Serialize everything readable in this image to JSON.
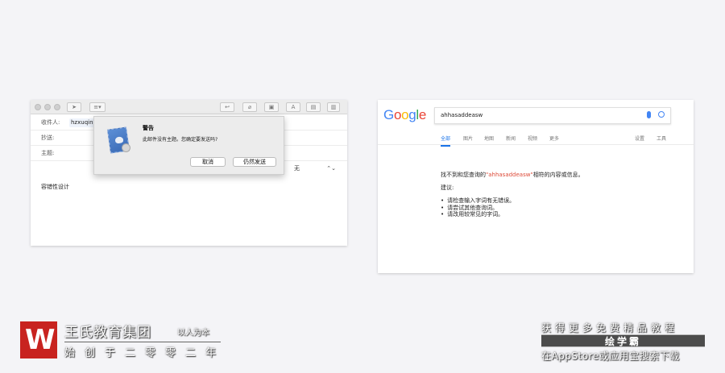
{
  "mail": {
    "to_label": "收件人:",
    "to_value": "hzxuqin",
    "cc_label": "抄送:",
    "subject_label": "主题:",
    "priority_value": "无",
    "body_text": "容错性设计"
  },
  "alert": {
    "title": "警告",
    "message": "此邮件没有主题。您确定要发送吗?",
    "cancel_label": "取消",
    "send_label": "仍然发送"
  },
  "google": {
    "logo": "Google",
    "query": "ahhasaddeasw",
    "tabs": [
      "全部",
      "图片",
      "地图",
      "新闻",
      "视频",
      "更多"
    ],
    "settings_label": "设置",
    "tools_label": "工具",
    "result_prefix": "找不到和您查询的",
    "result_query": "\"ahhasaddeasw\"",
    "result_suffix": "相符的内容或信息。",
    "suggestion_title": "建议:",
    "suggestions": [
      "请检查输入字词有无错误。",
      "请尝试其他查询词。",
      "请改用较常见的字词。"
    ],
    "colors": {
      "blue": "#4285f4",
      "red": "#ea4335",
      "yellow": "#fbbc05",
      "green": "#34a853"
    }
  },
  "footer": {
    "logo_letter": "W",
    "brand": "王氏教育集团",
    "slogan": "以人为本",
    "founded": "始创于二零零二年",
    "promo_line1": "获得更多免费精品教程",
    "promo_app": "绘学霸",
    "promo_line3": "在AppStore或应用宝搜索下载",
    "accent": "#c8231f"
  }
}
